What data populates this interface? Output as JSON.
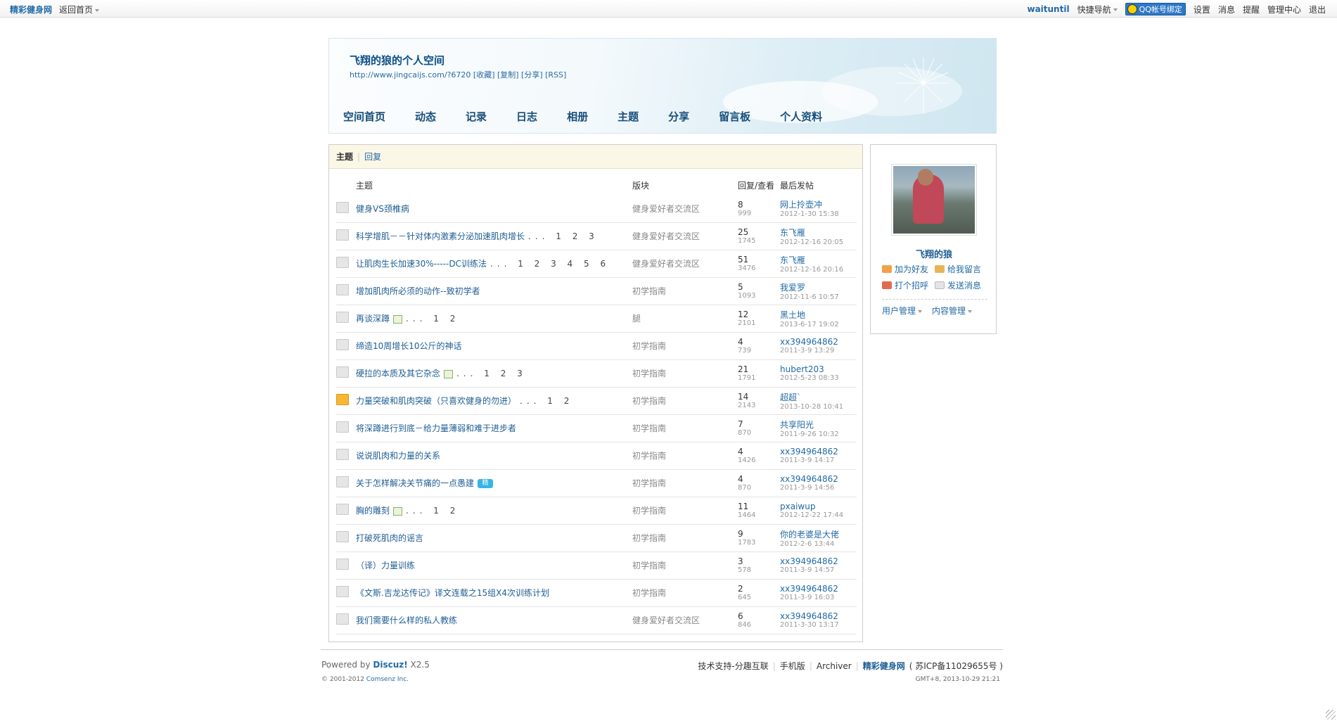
{
  "topbar": {
    "site": "精彩健身网",
    "back_home": "返回首页",
    "user": "waituntil",
    "quick_nav": "快捷导航",
    "qq_bind": "QQ帐号绑定",
    "links": [
      "设置",
      "消息",
      "提醒",
      "管理中心",
      "退出"
    ]
  },
  "header": {
    "title": "飞翔的狼的个人空间",
    "url": "http://www.jingcaijs.com/?6720 [收藏] [复制] [分享] [RSS]",
    "nav": [
      "空间首页",
      "动态",
      "记录",
      "日志",
      "相册",
      "主题",
      "分享",
      "留言板",
      "个人资料"
    ]
  },
  "tabs": {
    "active": "主题",
    "other": "回复"
  },
  "table": {
    "headers": {
      "subject": "主题",
      "forum": "版块",
      "stats": "回复/查看",
      "lastpost": "最后发帖"
    },
    "rows": [
      {
        "title": "健身VS颈椎病",
        "extra": "",
        "img": false,
        "digest": false,
        "hot": false,
        "forum": "健身爱好者交流区",
        "replies": "8",
        "views": "999",
        "lp_user": "网上拎壶冲",
        "lp_time": "2012-1-30 15:38"
      },
      {
        "title": "科学增肌－－针对体内激素分泌加速肌肉增长",
        "extra": "... 1 2 3",
        "img": false,
        "digest": false,
        "hot": false,
        "forum": "健身爱好者交流区",
        "replies": "25",
        "views": "1745",
        "lp_user": "东飞雁",
        "lp_time": "2012-12-16 20:05"
      },
      {
        "title": "让肌肉生长加速30%-----DC训练法",
        "extra": "... 1 2 3 4 5 6",
        "img": false,
        "digest": false,
        "hot": false,
        "forum": "健身爱好者交流区",
        "replies": "51",
        "views": "3476",
        "lp_user": "东飞雁",
        "lp_time": "2012-12-16 20:16"
      },
      {
        "title": "增加肌肉所必须的动作--致初学者",
        "extra": "",
        "img": false,
        "digest": false,
        "hot": false,
        "forum": "初学指南",
        "replies": "5",
        "views": "1093",
        "lp_user": "我爱罗",
        "lp_time": "2012-11-6 10:57"
      },
      {
        "title": "再谈深蹲",
        "extra": "... 1 2",
        "img": true,
        "digest": false,
        "hot": false,
        "forum": "腿",
        "replies": "12",
        "views": "2101",
        "lp_user": "黑土地",
        "lp_time": "2013-6-17 19:02"
      },
      {
        "title": "缔造10周增长10公斤的神话",
        "extra": "",
        "img": false,
        "digest": false,
        "hot": false,
        "forum": "初学指南",
        "replies": "4",
        "views": "739",
        "lp_user": "xx394964862",
        "lp_time": "2011-3-9 13:29"
      },
      {
        "title": "硬拉的本质及其它杂念",
        "extra": "... 1 2 3",
        "img": true,
        "digest": false,
        "hot": false,
        "forum": "初学指南",
        "replies": "21",
        "views": "1791",
        "lp_user": "hubert203",
        "lp_time": "2012-5-23 08:33"
      },
      {
        "title": "力量突破和肌肉突破（只喜欢健身的勿进）",
        "extra": "... 1 2",
        "img": false,
        "digest": false,
        "hot": true,
        "forum": "初学指南",
        "replies": "14",
        "views": "2143",
        "lp_user": "超超`",
        "lp_time": "2013-10-28 10:41"
      },
      {
        "title": "将深蹲进行到底－给力量薄弱和难于进步者",
        "extra": "",
        "img": false,
        "digest": false,
        "hot": false,
        "forum": "初学指南",
        "replies": "7",
        "views": "870",
        "lp_user": "共享阳光",
        "lp_time": "2011-9-26 10:32"
      },
      {
        "title": "说说肌肉和力量的关系",
        "extra": "",
        "img": false,
        "digest": false,
        "hot": false,
        "forum": "初学指南",
        "replies": "4",
        "views": "1426",
        "lp_user": "xx394964862",
        "lp_time": "2011-3-9 14:17"
      },
      {
        "title": "关于怎样解决关节痛的一点愚建",
        "extra": "",
        "img": false,
        "digest": true,
        "hot": false,
        "forum": "初学指南",
        "replies": "4",
        "views": "870",
        "lp_user": "xx394964862",
        "lp_time": "2011-3-9 14:56"
      },
      {
        "title": "胸的雕刻",
        "extra": "... 1 2",
        "img": true,
        "digest": false,
        "hot": false,
        "forum": "初学指南",
        "replies": "11",
        "views": "1464",
        "lp_user": "pxaiwup",
        "lp_time": "2012-12-22 17:44"
      },
      {
        "title": "打破死肌肉的谣言",
        "extra": "",
        "img": false,
        "digest": false,
        "hot": false,
        "forum": "初学指南",
        "replies": "9",
        "views": "1783",
        "lp_user": "你的老婆是大佬",
        "lp_time": "2012-2-6 13:44"
      },
      {
        "title": "（译）力量训练",
        "extra": "",
        "img": false,
        "digest": false,
        "hot": false,
        "forum": "初学指南",
        "replies": "3",
        "views": "578",
        "lp_user": "xx394964862",
        "lp_time": "2011-3-9 14:57"
      },
      {
        "title": "《文斯.吉龙达传记》译文连载之15组X4次训练计划",
        "extra": "",
        "img": false,
        "digest": false,
        "hot": false,
        "forum": "初学指南",
        "replies": "2",
        "views": "645",
        "lp_user": "xx394964862",
        "lp_time": "2011-3-9 16:03"
      },
      {
        "title": "我们需要什么样的私人教练",
        "extra": "",
        "img": false,
        "digest": false,
        "hot": false,
        "forum": "健身爱好者交流区",
        "replies": "6",
        "views": "846",
        "lp_user": "xx394964862",
        "lp_time": "2011-3-30 13:17"
      }
    ]
  },
  "sidebar": {
    "username": "飞翔的狼",
    "actions": [
      "加为好友",
      "给我留言",
      "打个招呼",
      "发送消息"
    ],
    "user_mgmt": "用户管理",
    "content_mgmt": "内容管理"
  },
  "footer": {
    "powered_prefix": "Powered by ",
    "powered_brand": "Discuz!",
    "powered_ver": " X2.5",
    "copyright_prefix": "© 2001-2012 ",
    "copyright_brand": "Comsenz Inc.",
    "links": [
      "技术支持-分趣互联",
      "手机版",
      "Archiver"
    ],
    "site": "精彩健身网",
    "icp": "( 苏ICP备11029655号 )",
    "gmt": "GMT+8, 2013-10-29 21:21"
  }
}
